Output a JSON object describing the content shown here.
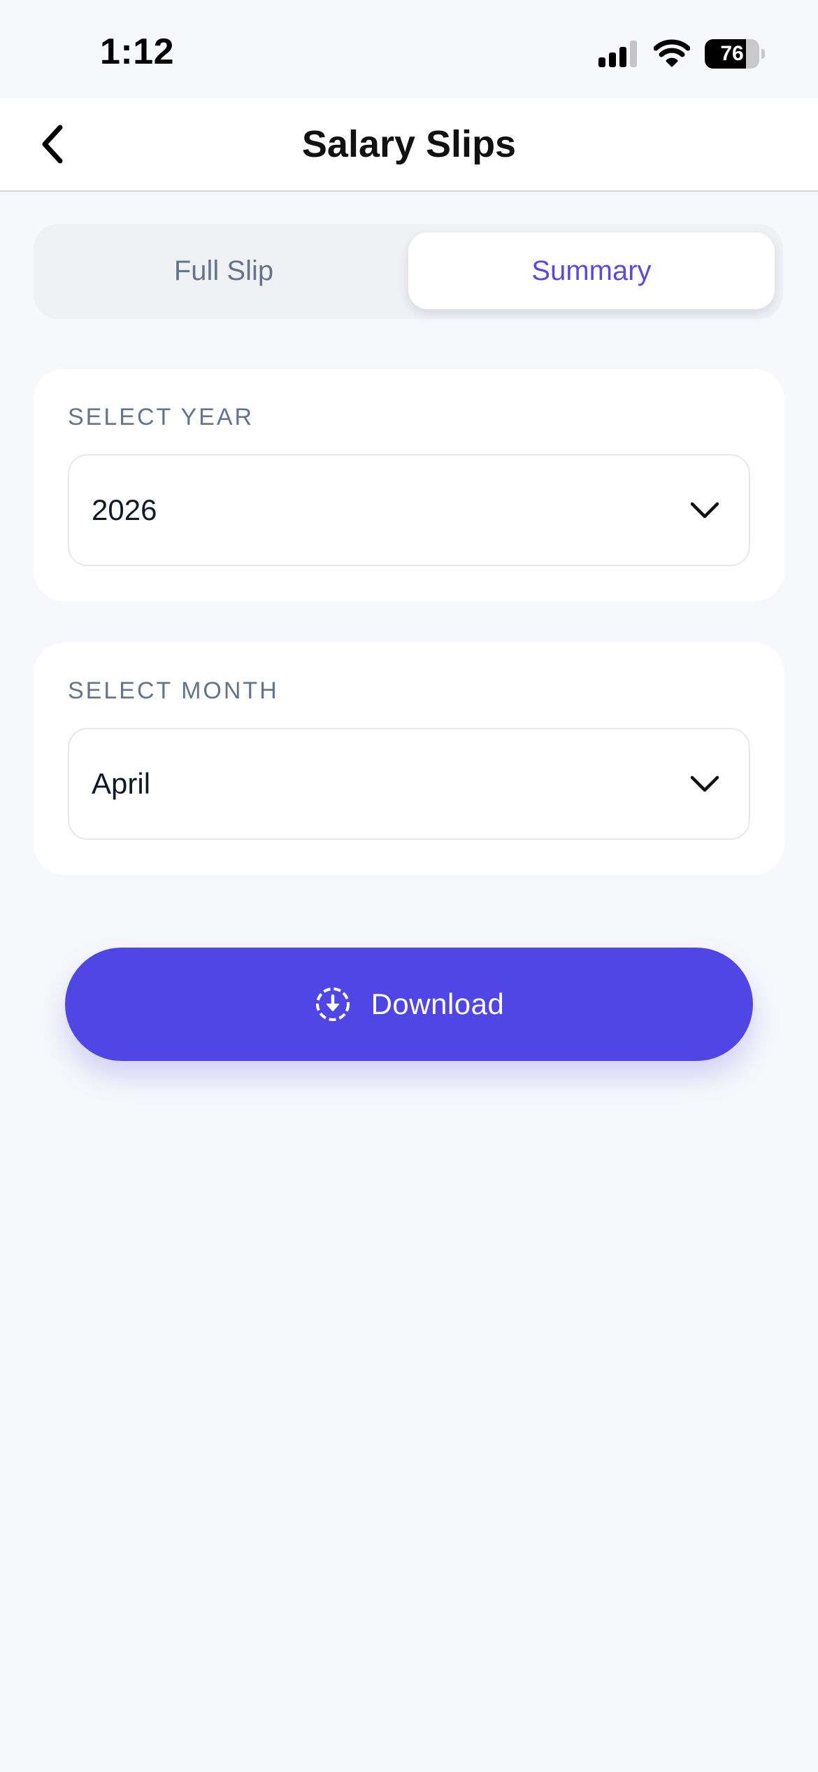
{
  "status_bar": {
    "time": "1:12",
    "battery_level": 76,
    "battery_label": "76"
  },
  "nav": {
    "title": "Salary Slips"
  },
  "segments": {
    "options": [
      "Full Slip",
      "Summary"
    ],
    "selected": "Summary"
  },
  "year_card": {
    "label": "SELECT YEAR",
    "value": "2026"
  },
  "month_card": {
    "label": "SELECT MONTH",
    "value": "April"
  },
  "download": {
    "label": "Download",
    "icon": "download-circle-icon"
  },
  "colors": {
    "accent": "#5046e6",
    "segment_active_text": "#5d4ad9",
    "muted_text": "#66748a",
    "background": "#f7f8fb"
  }
}
